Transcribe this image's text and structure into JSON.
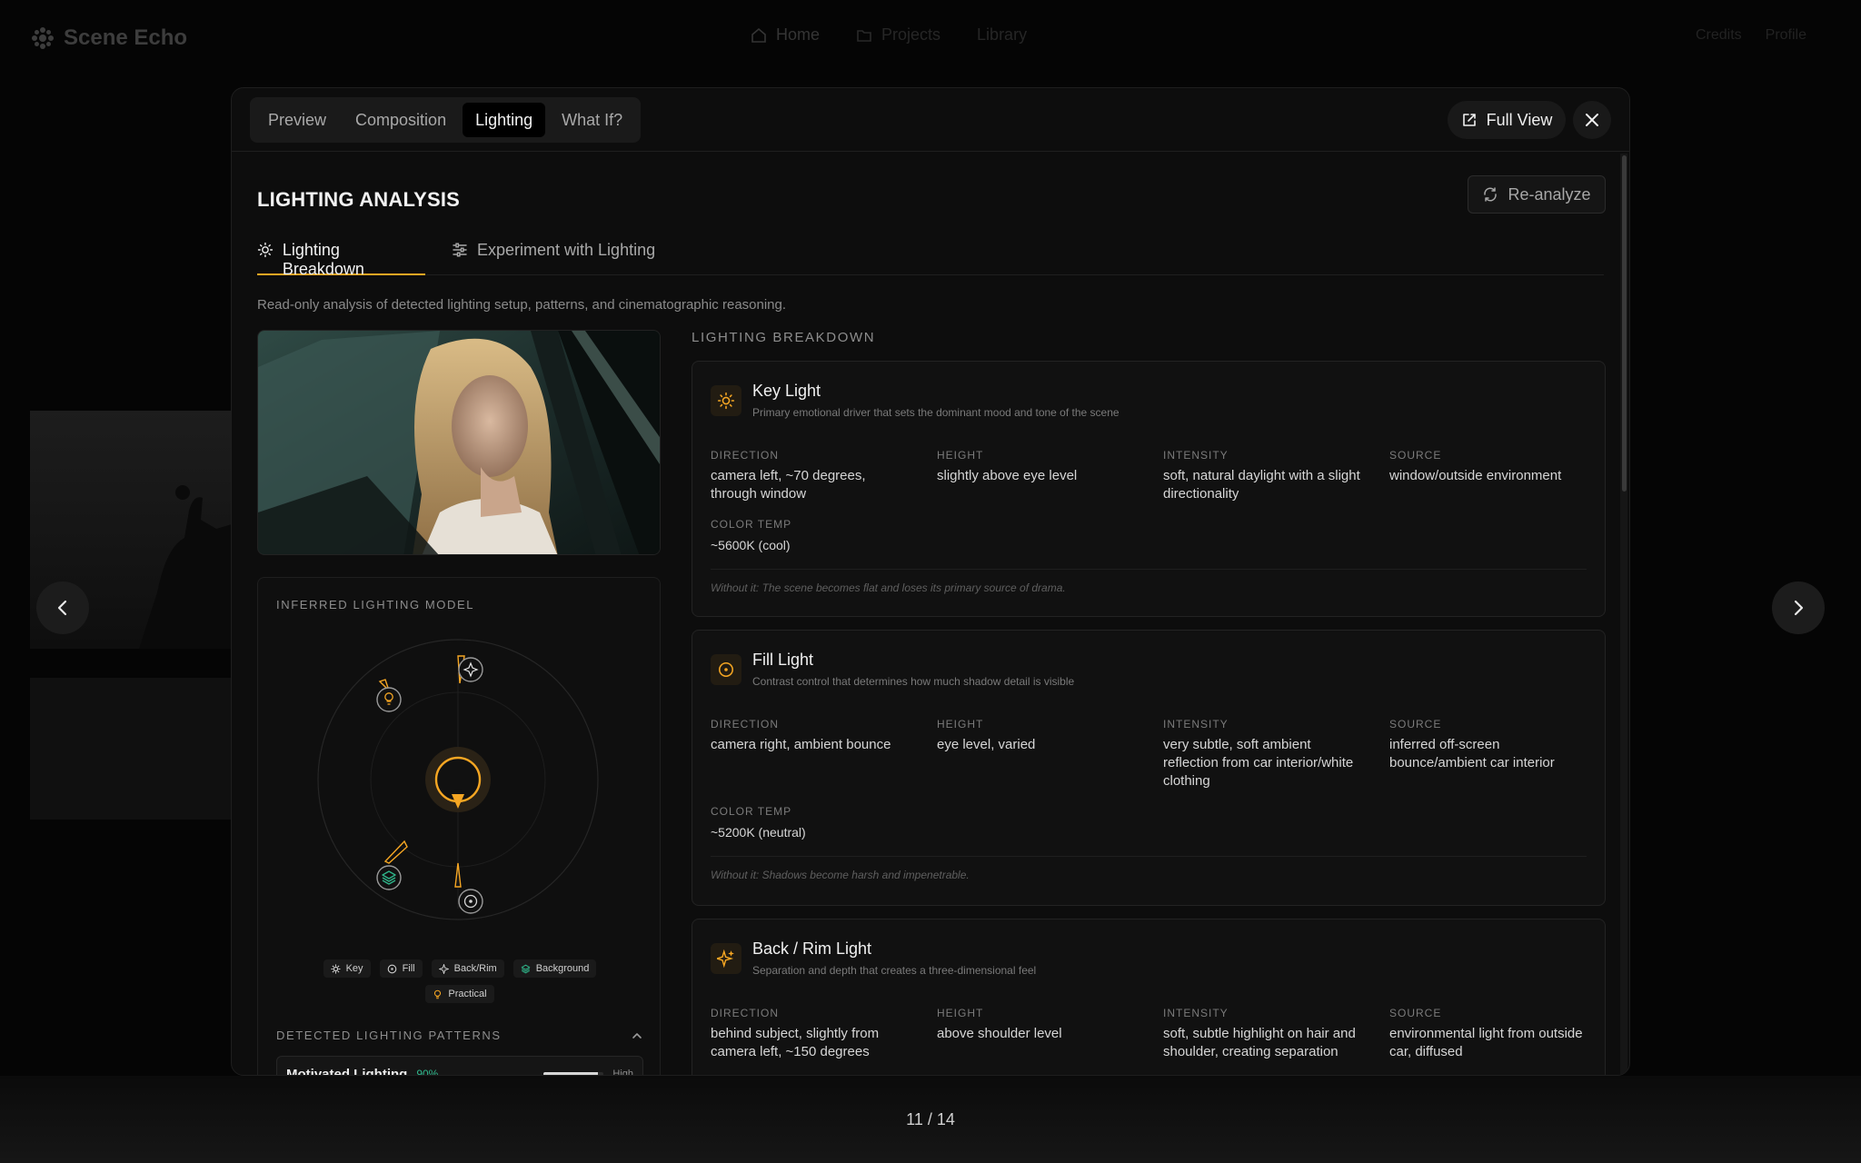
{
  "app": {
    "name": "Scene Echo",
    "nav": [
      "Home",
      "Projects",
      "Library"
    ],
    "right": [
      "Credits",
      "Profile"
    ]
  },
  "modal": {
    "tabs": [
      "Preview",
      "Composition",
      "Lighting",
      "What If?"
    ],
    "active_tab": "Lighting",
    "full_view_label": "Full View",
    "title": "LIGHTING ANALYSIS",
    "reanalyze_label": "Re-analyze",
    "subtabs": [
      "Lighting Breakdown",
      "Experiment with Lighting"
    ],
    "description": "Read-only analysis of detected lighting setup, patterns, and cinematographic reasoning."
  },
  "model": {
    "label": "INFERRED LIGHTING MODEL",
    "legend": [
      "Key",
      "Fill",
      "Back/Rim",
      "Background",
      "Practical"
    ],
    "patterns_label": "DETECTED LIGHTING PATTERNS",
    "pattern": {
      "name": "Motivated Lighting",
      "confidence": "90%",
      "fill_fraction": 0.9,
      "level": "High"
    }
  },
  "breakdown": {
    "label": "LIGHTING BREAKDOWN",
    "prop_labels": {
      "direction": "DIRECTION",
      "height": "HEIGHT",
      "intensity": "INTENSITY",
      "source": "SOURCE",
      "color_temp": "COLOR TEMP"
    },
    "cards": [
      {
        "title": "Key Light",
        "subtitle": "Primary emotional driver that sets the dominant mood and tone of the scene",
        "direction": "camera left, ~70 degrees, through window",
        "height": "slightly above eye level",
        "intensity": "soft, natural daylight with a slight directionality",
        "source": "window/outside environment",
        "color_temp": "~5600K (cool)",
        "without": "Without it: The scene becomes flat and loses its primary source of drama."
      },
      {
        "title": "Fill Light",
        "subtitle": "Contrast control that determines how much shadow detail is visible",
        "direction": "camera right, ambient bounce",
        "height": "eye level, varied",
        "intensity": "very subtle, soft ambient reflection from car interior/white clothing",
        "source": "inferred off-screen bounce/ambient car interior",
        "color_temp": "~5200K (neutral)",
        "without": "Without it: Shadows become harsh and impenetrable."
      },
      {
        "title": "Back / Rim Light",
        "subtitle": "Separation and depth that creates a three-dimensional feel",
        "direction": "behind subject, slightly from camera left, ~150 degrees",
        "height": "above shoulder level",
        "intensity": "soft, subtle highlight on hair and shoulder, creating separation",
        "source": "environmental light from outside car, diffused"
      }
    ]
  },
  "pager": {
    "counter": "11 / 14"
  },
  "colors": {
    "accent": "#f5a623",
    "teal": "#2fb58a",
    "bg": "#0d0d0d"
  }
}
